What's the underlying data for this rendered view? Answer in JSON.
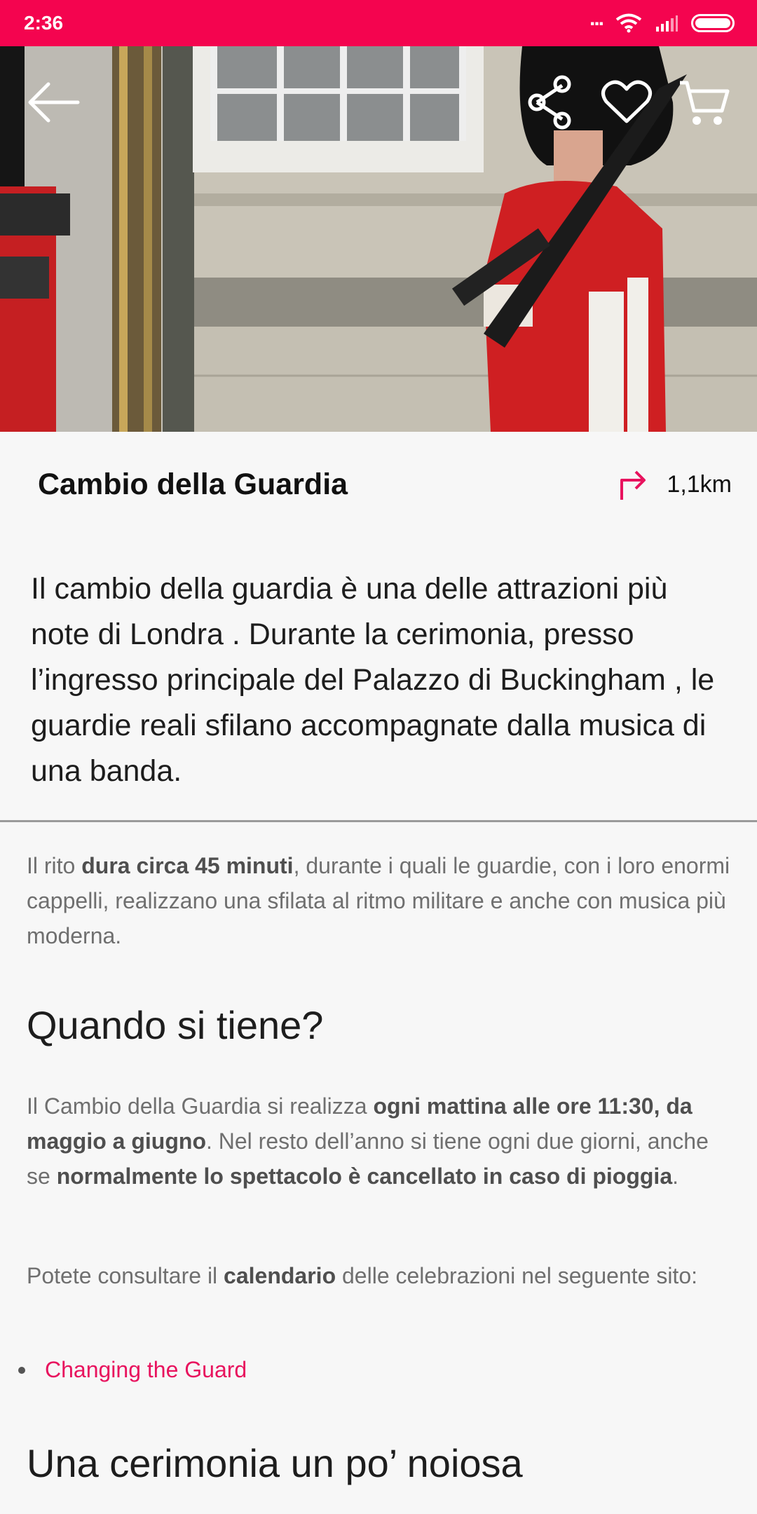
{
  "status": {
    "time": "2:36",
    "dots": "..."
  },
  "title": "Cambio della Guardia",
  "distance": "1,1km",
  "lead": "Il cambio della guardia è una delle attrazioni più note di Londra . Durante la cerimonia, presso l’ingresso principale del  Palazzo di Buckingham , le guardie reali sfilano accompagnate dalla musica di una banda.",
  "p1": {
    "a": "Il rito ",
    "b": "dura circa 45 minuti",
    "c": ", durante i quali le guardie, con i loro enormi cappelli, realizzano una sfilata al ritmo militare e anche con musica più moderna."
  },
  "h_when": "Quando si tiene?",
  "p2": {
    "a": "Il Cambio della Guardia si realizza ",
    "b": "ogni mattina alle ore 11:30, da maggio a giugno",
    "c": ". Nel resto dell’anno si tiene ogni due giorni, anche se ",
    "d": "normalmente lo spettacolo è cancellato in caso di pioggia",
    "e": "."
  },
  "p3": {
    "a": "Potete consultare il ",
    "b": "calendario",
    "c": " delle celebrazioni nel seguente sito:"
  },
  "link": "Changing the Guard",
  "h_boring": "Una cerimonia un po’ noiosa",
  "icons": {
    "back": "arrow-left-icon",
    "share": "share-icon",
    "favorite": "heart-icon",
    "cart": "cart-icon",
    "direction": "turn-right-icon"
  },
  "colors": {
    "accent": "#f4044f",
    "link": "#e8135e"
  }
}
